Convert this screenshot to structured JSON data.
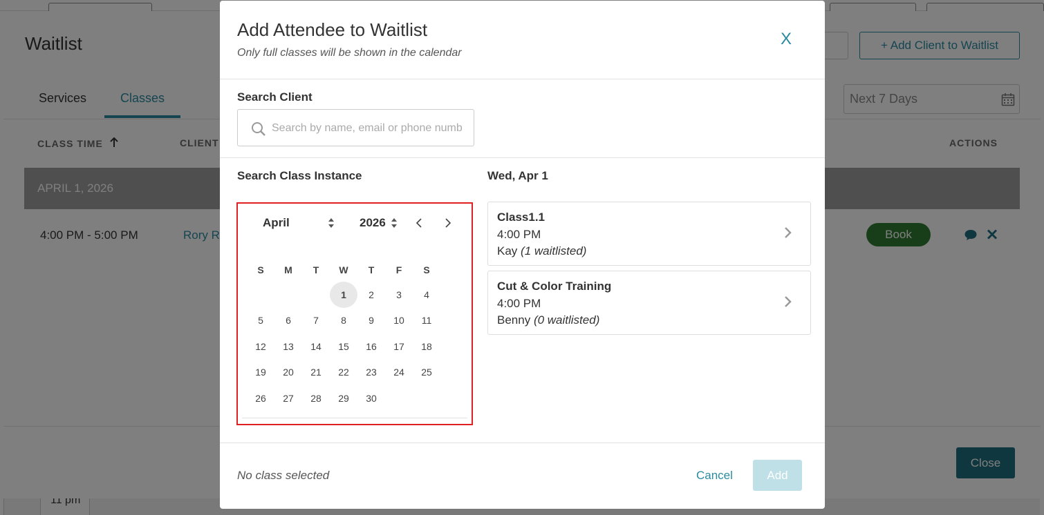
{
  "background": {
    "gutter_time": "11 pm"
  },
  "panel": {
    "title": "Waitlist",
    "add_client_label": "+ Add Client to Waitlist",
    "tabs": [
      {
        "label": "Services",
        "active": false
      },
      {
        "label": "Classes",
        "active": true
      }
    ],
    "date_range": "Next 7 Days",
    "headers": {
      "class_time": "CLASS TIME",
      "client": "CLIENT",
      "actions": "ACTIONS"
    },
    "sort_icon": "arrow-up-icon",
    "date_group": "APRIL 1, 2026",
    "row": {
      "time": "4:00 PM - 5:00 PM",
      "client": "Rory R",
      "book_label": "Book"
    },
    "close_label": "Close"
  },
  "modal": {
    "title": "Add Attendee to Waitlist",
    "subtitle": "Only full classes will be shown in the calendar",
    "close_label": "X",
    "search_label": "Search Client",
    "search_placeholder": "Search by name, email or phone number",
    "search_value": "",
    "class_instance_label": "Search Class Instance",
    "selected_date_label": "Wed, Apr 1",
    "calendar": {
      "month": "April",
      "year": "2026",
      "weekdays": [
        "S",
        "M",
        "T",
        "W",
        "T",
        "F",
        "S"
      ],
      "selected_day": "1",
      "days": [
        [
          "",
          "",
          "",
          "1",
          "2",
          "3",
          "4"
        ],
        [
          "5",
          "6",
          "7",
          "8",
          "9",
          "10",
          "11"
        ],
        [
          "12",
          "13",
          "14",
          "15",
          "16",
          "17",
          "18"
        ],
        [
          "19",
          "20",
          "21",
          "22",
          "23",
          "24",
          "25"
        ],
        [
          "26",
          "27",
          "28",
          "29",
          "30",
          "",
          ""
        ]
      ]
    },
    "classes": [
      {
        "name": "Class1.1",
        "time": "4:00 PM",
        "instructor": "Kay",
        "waitlisted": "(1 waitlisted)"
      },
      {
        "name": "Cut & Color Training",
        "time": "4:00 PM",
        "instructor": "Benny",
        "waitlisted": "(0 waitlisted)"
      }
    ],
    "footer_status": "No class selected",
    "cancel_label": "Cancel",
    "add_label": "Add",
    "accent_color": "#2a8aa0",
    "highlight_color": "#e02020"
  }
}
